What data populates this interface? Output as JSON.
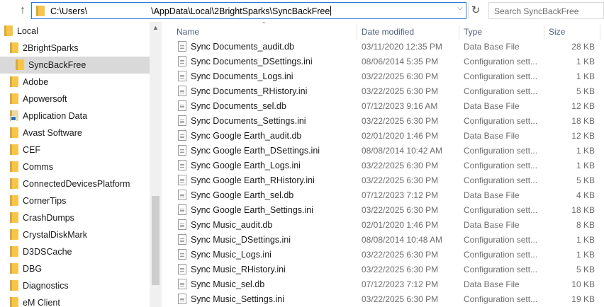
{
  "address_bar": {
    "path_prefix": "C:\\Users\\",
    "path_suffix": "\\AppData\\Local\\2BrightSparks\\SyncBackFree"
  },
  "search": {
    "placeholder": "Search SyncBackFree"
  },
  "nav_pane": {
    "items": [
      {
        "label": "Local",
        "level": 0,
        "selected": false,
        "icon": "folder-icon"
      },
      {
        "label": "2BrightSparks",
        "level": 1,
        "selected": false,
        "icon": "folder-icon"
      },
      {
        "label": "SyncBackFree",
        "level": 2,
        "selected": true,
        "icon": "folder-icon"
      },
      {
        "label": "Adobe",
        "level": 1,
        "selected": false,
        "icon": "folder-icon"
      },
      {
        "label": "Apowersoft",
        "level": 1,
        "selected": false,
        "icon": "folder-icon"
      },
      {
        "label": "Application Data",
        "level": 1,
        "selected": false,
        "icon": "system-folder-shortcut-icon"
      },
      {
        "label": "Avast Software",
        "level": 1,
        "selected": false,
        "icon": "folder-icon"
      },
      {
        "label": "CEF",
        "level": 1,
        "selected": false,
        "icon": "folder-icon"
      },
      {
        "label": "Comms",
        "level": 1,
        "selected": false,
        "icon": "folder-icon"
      },
      {
        "label": "ConnectedDevicesPlatform",
        "level": 1,
        "selected": false,
        "icon": "folder-icon"
      },
      {
        "label": "CornerTips",
        "level": 1,
        "selected": false,
        "icon": "folder-icon"
      },
      {
        "label": "CrashDumps",
        "level": 1,
        "selected": false,
        "icon": "folder-icon"
      },
      {
        "label": "CrystalDiskMark",
        "level": 1,
        "selected": false,
        "icon": "folder-icon"
      },
      {
        "label": "D3DSCache",
        "level": 1,
        "selected": false,
        "icon": "folder-icon"
      },
      {
        "label": "DBG",
        "level": 1,
        "selected": false,
        "icon": "folder-icon"
      },
      {
        "label": "Diagnostics",
        "level": 1,
        "selected": false,
        "icon": "folder-icon"
      },
      {
        "label": "eM Client",
        "level": 1,
        "selected": false,
        "icon": "folder-icon"
      }
    ]
  },
  "file_list": {
    "columns": {
      "name": "Name",
      "date": "Date modified",
      "type": "Type",
      "size": "Size"
    },
    "sorted_by": "Name",
    "rows": [
      {
        "name": "Sync Documents_audit.db",
        "date": "03/11/2020 12:35 PM",
        "type": "Data Base File",
        "size": "28 KB"
      },
      {
        "name": "Sync Documents_DSettings.ini",
        "date": "08/06/2014 5:35 PM",
        "type": "Configuration sett...",
        "size": "1 KB"
      },
      {
        "name": "Sync Documents_Logs.ini",
        "date": "03/22/2025 6:30 PM",
        "type": "Configuration sett...",
        "size": "1 KB"
      },
      {
        "name": "Sync Documents_RHistory.ini",
        "date": "03/22/2025 6:30 PM",
        "type": "Configuration sett...",
        "size": "5 KB"
      },
      {
        "name": "Sync Documents_sel.db",
        "date": "07/12/2023 9:16 AM",
        "type": "Data Base File",
        "size": "12 KB"
      },
      {
        "name": "Sync Documents_Settings.ini",
        "date": "03/22/2025 6:30 PM",
        "type": "Configuration sett...",
        "size": "18 KB"
      },
      {
        "name": "Sync Google Earth_audit.db",
        "date": "02/01/2020 1:46 PM",
        "type": "Data Base File",
        "size": "12 KB"
      },
      {
        "name": "Sync Google Earth_DSettings.ini",
        "date": "08/08/2014 10:42 AM",
        "type": "Configuration sett...",
        "size": "1 KB"
      },
      {
        "name": "Sync Google Earth_Logs.ini",
        "date": "03/22/2025 6:30 PM",
        "type": "Configuration sett...",
        "size": "1 KB"
      },
      {
        "name": "Sync Google Earth_RHistory.ini",
        "date": "03/22/2025 6:30 PM",
        "type": "Configuration sett...",
        "size": "5 KB"
      },
      {
        "name": "Sync Google Earth_sel.db",
        "date": "07/12/2023 7:12 PM",
        "type": "Data Base File",
        "size": "4 KB"
      },
      {
        "name": "Sync Google Earth_Settings.ini",
        "date": "03/22/2025 6:30 PM",
        "type": "Configuration sett...",
        "size": "18 KB"
      },
      {
        "name": "Sync Music_audit.db",
        "date": "02/01/2020 1:46 PM",
        "type": "Data Base File",
        "size": "8 KB"
      },
      {
        "name": "Sync Music_DSettings.ini",
        "date": "08/08/2014 10:48 AM",
        "type": "Configuration sett...",
        "size": "1 KB"
      },
      {
        "name": "Sync Music_Logs.ini",
        "date": "03/22/2025 6:30 PM",
        "type": "Configuration sett...",
        "size": "1 KB"
      },
      {
        "name": "Sync Music_RHistory.ini",
        "date": "03/22/2025 6:30 PM",
        "type": "Configuration sett...",
        "size": "5 KB"
      },
      {
        "name": "Sync Music_sel.db",
        "date": "07/12/2023 7:12 PM",
        "type": "Data Base File",
        "size": "10 KB"
      },
      {
        "name": "Sync Music_Settings.ini",
        "date": "03/22/2025 6:30 PM",
        "type": "Configuration sett...",
        "size": "19 KB"
      }
    ]
  },
  "icons": {
    "up": "up-arrow-icon",
    "refresh": "refresh-icon",
    "address_dropdown": "chevron-down-icon",
    "file": "file-icon"
  },
  "colors": {
    "address_border": "#2b7bd6",
    "selected_bg": "#d9d9d9",
    "folder": "#f6c64a",
    "header_text": "#4c607a"
  }
}
